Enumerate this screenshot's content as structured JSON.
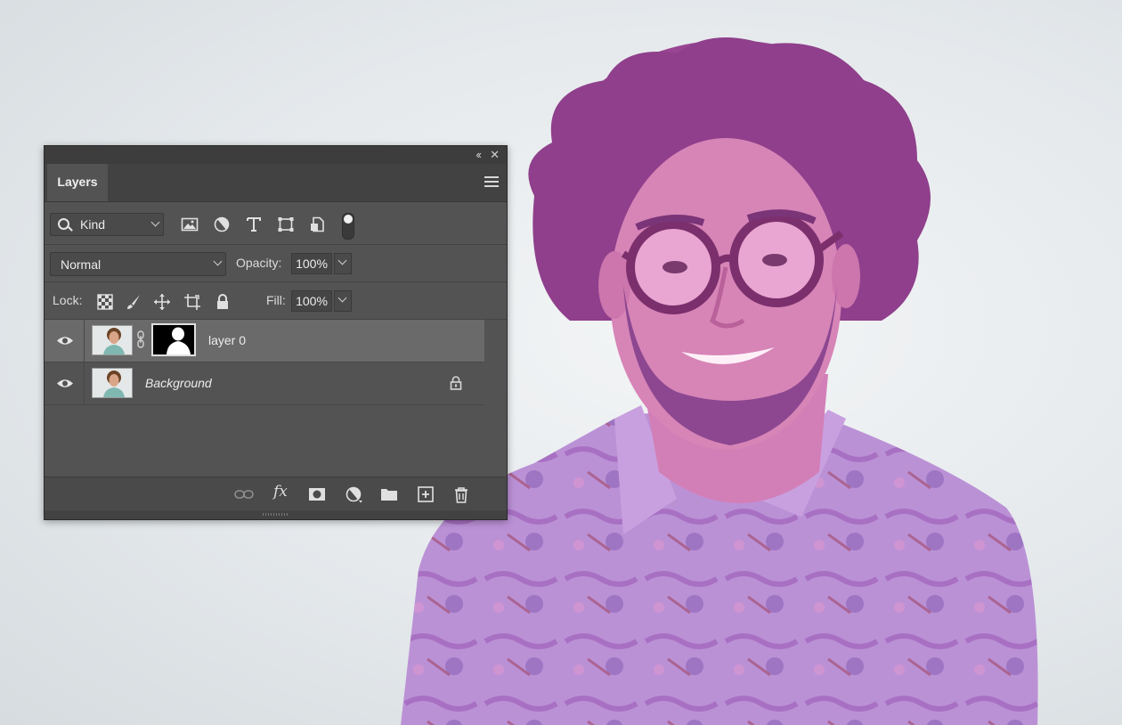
{
  "panel": {
    "tab_label": "Layers",
    "filter": {
      "kind_label": "Kind"
    },
    "blend": {
      "mode": "Normal",
      "opacity_label": "Opacity:",
      "opacity_value": "100%"
    },
    "lock": {
      "label": "Lock:",
      "fill_label": "Fill:",
      "fill_value": "100%"
    },
    "layers": [
      {
        "name": "layer 0",
        "visible": true,
        "selected": true,
        "has_mask": true
      },
      {
        "name": "Background",
        "visible": true,
        "selected": false,
        "locked": true
      }
    ]
  },
  "colors": {
    "panel_bg": "#535353",
    "selected_layer": "#6a6a6a",
    "photo_tint": "#b46ab4"
  },
  "icons": {
    "title_bar": [
      "collapse-icon",
      "close-icon"
    ],
    "filter": [
      "image-filter-icon",
      "adjustment-filter-icon",
      "type-filter-icon",
      "shape-filter-icon",
      "smart-object-filter-icon",
      "filter-toggle"
    ],
    "lock": [
      "lock-transparent-pixels-icon",
      "lock-image-pixels-icon",
      "lock-position-icon",
      "prevent-autonest-icon",
      "lock-all-icon"
    ],
    "bottom": [
      "link-layers-icon",
      "fx-icon",
      "add-mask-icon",
      "adjustment-layer-icon",
      "new-group-icon",
      "new-layer-icon",
      "trash-icon"
    ]
  }
}
